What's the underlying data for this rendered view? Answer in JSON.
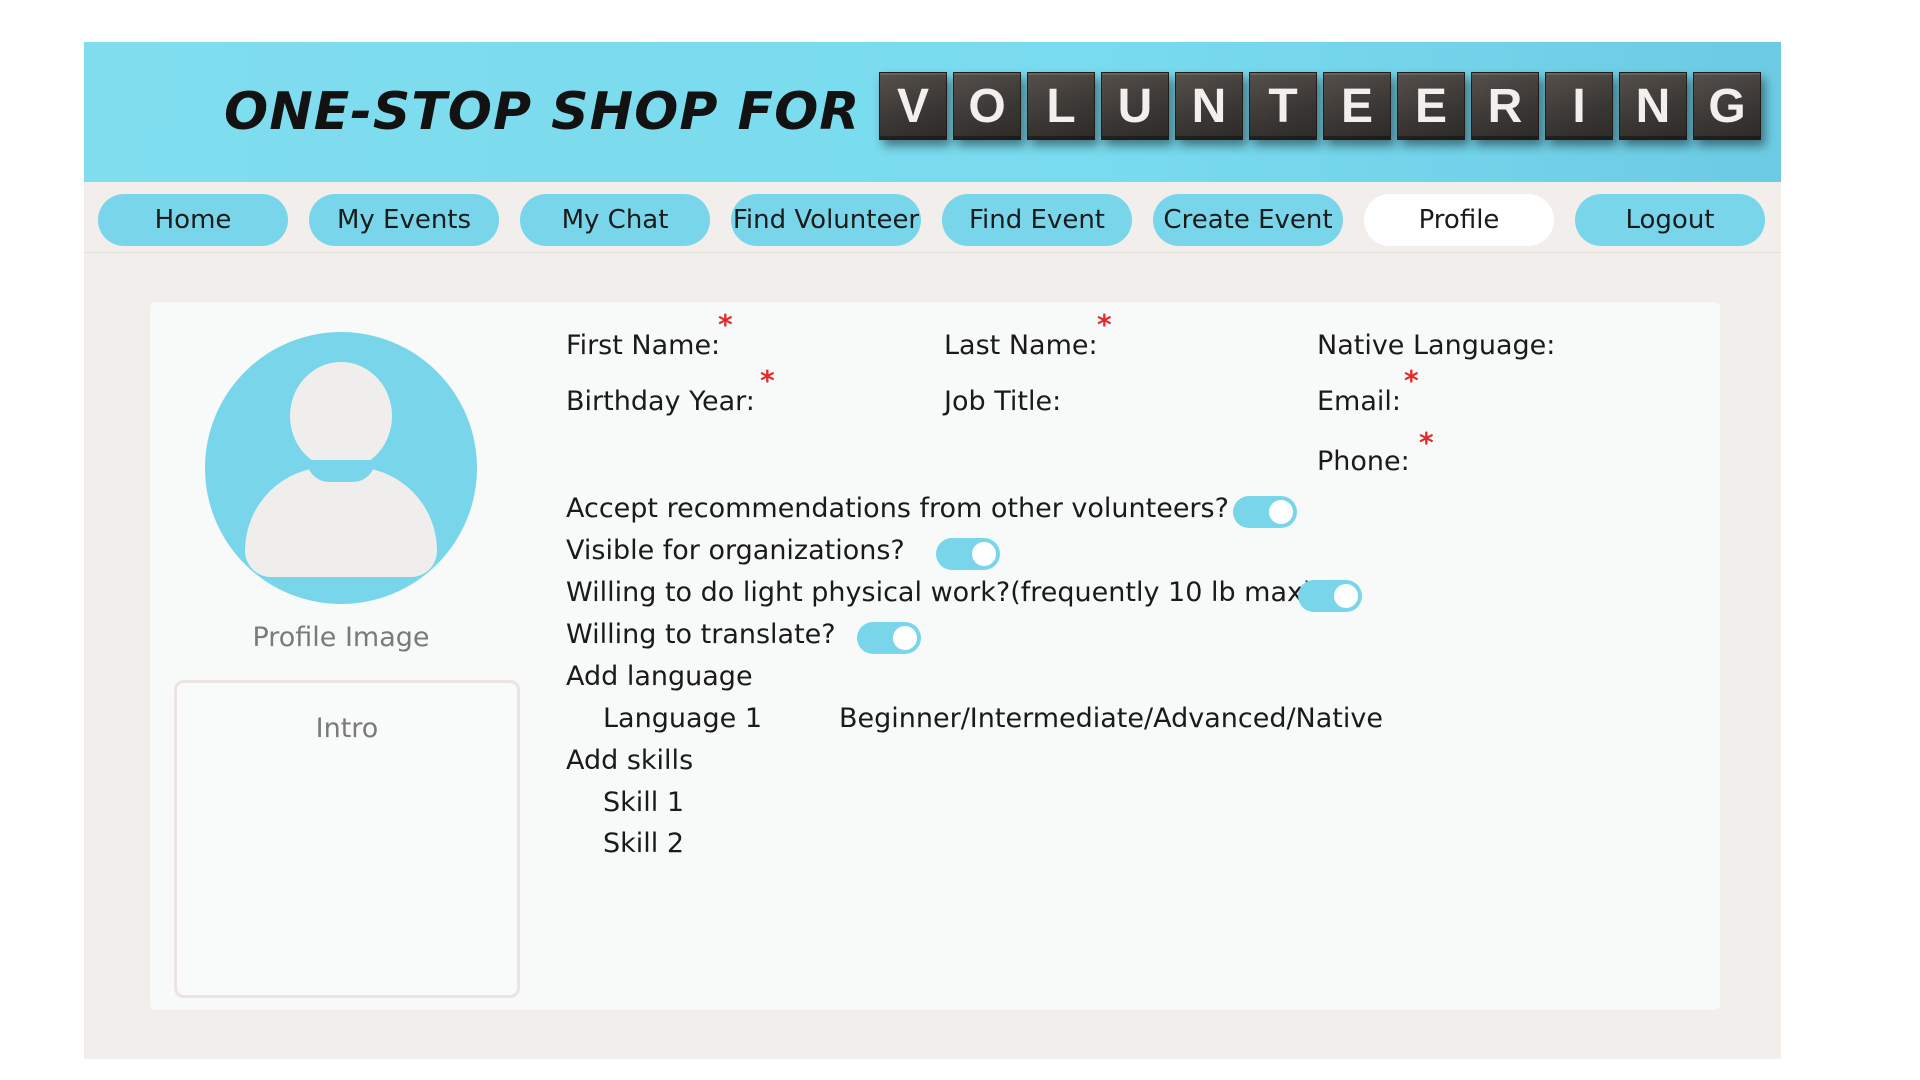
{
  "header": {
    "title": "ONE-STOP SHOP FOR",
    "tiles": [
      "V",
      "O",
      "L",
      "U",
      "N",
      "T",
      "E",
      "E",
      "R",
      "I",
      "N",
      "G"
    ]
  },
  "nav": {
    "items": [
      {
        "label": "Home"
      },
      {
        "label": "My Events"
      },
      {
        "label": "My Chat"
      },
      {
        "label": "Find Volunteer"
      },
      {
        "label": "Find Event"
      },
      {
        "label": "Create Event"
      },
      {
        "label": "Profile",
        "active": true
      },
      {
        "label": "Logout"
      }
    ]
  },
  "profile": {
    "image_label": "Profile Image",
    "intro_label": "Intro",
    "fields": {
      "first_name": "First Name:",
      "last_name": "Last Name:",
      "native_language": "Native Language:",
      "birthday_year": "Birthday Year:",
      "job_title": "Job Title:",
      "email": "Email:",
      "phone": "Phone:"
    },
    "required_marker": "*",
    "toggles": [
      {
        "label": "Accept recommendations from other volunteers?",
        "on": true
      },
      {
        "label": "Visible for organizations?",
        "on": true
      },
      {
        "label": "Willing to do light physical work?(frequently 10 lb max)",
        "on": true
      },
      {
        "label": "Willing to translate?",
        "on": true
      }
    ],
    "add_language_label": "Add language",
    "language_item": "Language 1",
    "language_levels": "Beginner/Intermediate/Advanced/Native",
    "add_skills_label": "Add skills",
    "skills": [
      "Skill 1",
      "Skill 2"
    ]
  },
  "colors": {
    "accent": "#79d6ea",
    "background": "#f1eeeb",
    "card": "#f8fafa",
    "required": "#e22c2c"
  }
}
